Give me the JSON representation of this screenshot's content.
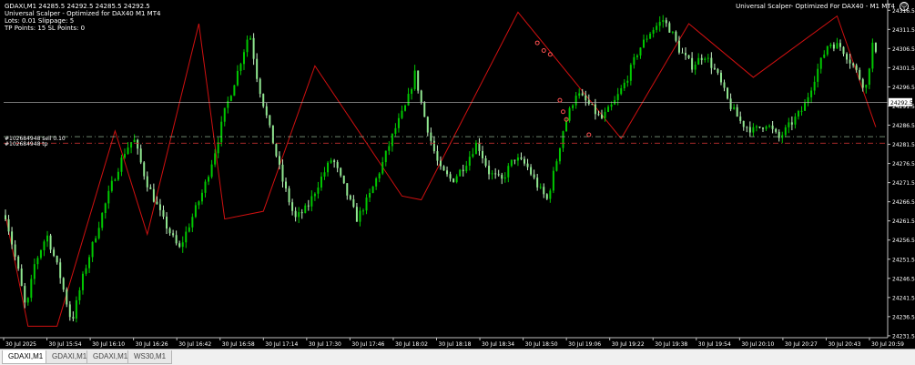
{
  "chart_info": {
    "symbol_line": "GDAXI,M1  24285.5 24292.5 24285.5 24292.5",
    "indicator_line": "Universal Scalper - Optimized for DAX40 M1 MT4",
    "lots_line": "Lots: 0.01  Slippage: 5",
    "points_line": "TP Points: 15  SL Points: 0"
  },
  "indicator_title": "Universal Scalper- Optimized For DAX40 - M1 MT4",
  "smiley_icon": "☺",
  "orders": {
    "sell_label": "#102684948 sell 0.10",
    "tp_label": "#102684948 tp"
  },
  "tabs": [
    {
      "label": "GDAXI,M1",
      "active": true
    },
    {
      "label": "GDAXI,M1",
      "active": false
    },
    {
      "label": "GDAXI,M1",
      "active": false
    },
    {
      "label": "WS30,M1",
      "active": false
    }
  ],
  "colors": {
    "background": "#000000",
    "candle_bull": "#00c800",
    "candle_bear": "#c8f0c8",
    "zigzag": "#d01010",
    "axis": "#c0c0c0",
    "bid_line": "#c0c0c0",
    "sell_line": "#90b090",
    "tp_line": "#c03030",
    "markers": "#ff5050"
  },
  "chart_data": {
    "type": "candlestick",
    "symbol": "GDAXI",
    "timeframe": "M1",
    "ylim": [
      24231.0,
      24318.0
    ],
    "y_ticks": [
      "24316.5",
      "24311.5",
      "24306.5",
      "24301.5",
      "24296.5",
      "24291.5",
      "24286.5",
      "24281.5",
      "24276.5",
      "24271.5",
      "24266.5",
      "24261.5",
      "24256.5",
      "24251.5",
      "24246.5",
      "24241.5",
      "24236.5",
      "24231.5"
    ],
    "x_ticks": [
      "30 Jul 2025",
      "30 Jul 15:54",
      "30 Jul 16:10",
      "30 Jul 16:26",
      "30 Jul 16:42",
      "30 Jul 16:58",
      "30 Jul 17:14",
      "30 Jul 17:30",
      "30 Jul 17:46",
      "30 Jul 18:02",
      "30 Jul 18:18",
      "30 Jul 18:34",
      "30 Jul 18:50",
      "30 Jul 19:06",
      "30 Jul 19:22",
      "30 Jul 19:38",
      "30 Jul 19:54",
      "30 Jul 20:10",
      "30 Jul 20:27",
      "30 Jul 20:43",
      "30 Jul 20:59"
    ],
    "current_price": "24292.5",
    "bid": 24292.5,
    "sell_price": 24283.5,
    "tp_price": 24281.8,
    "grid": false,
    "path": [
      [
        0,
        24263
      ],
      [
        3,
        24249
      ],
      [
        5,
        24238
      ],
      [
        7,
        24250
      ],
      [
        10,
        24258
      ],
      [
        13,
        24248
      ],
      [
        16,
        24235
      ],
      [
        19,
        24248
      ],
      [
        23,
        24262
      ],
      [
        26,
        24272
      ],
      [
        29,
        24280
      ],
      [
        31,
        24283
      ],
      [
        34,
        24272
      ],
      [
        38,
        24262
      ],
      [
        42,
        24254
      ],
      [
        45,
        24262
      ],
      [
        48,
        24270
      ],
      [
        51,
        24281
      ],
      [
        53,
        24290
      ],
      [
        56,
        24300
      ],
      [
        59,
        24311
      ],
      [
        61,
        24298
      ],
      [
        64,
        24285
      ],
      [
        67,
        24272
      ],
      [
        70,
        24262
      ],
      [
        73,
        24265
      ],
      [
        76,
        24272
      ],
      [
        79,
        24278
      ],
      [
        82,
        24270
      ],
      [
        85,
        24262
      ],
      [
        88,
        24268
      ],
      [
        91,
        24276
      ],
      [
        94,
        24285
      ],
      [
        97,
        24292
      ],
      [
        99,
        24300
      ],
      [
        101,
        24290
      ],
      [
        103,
        24282
      ],
      [
        105,
        24275
      ],
      [
        108,
        24272
      ],
      [
        111,
        24276
      ],
      [
        114,
        24282
      ],
      [
        117,
        24274
      ],
      [
        120,
        24272
      ],
      [
        123,
        24278
      ],
      [
        126,
        24276
      ],
      [
        129,
        24270
      ],
      [
        131,
        24267
      ],
      [
        133,
        24276
      ],
      [
        135,
        24286
      ],
      [
        138,
        24295
      ],
      [
        141,
        24292
      ],
      [
        144,
        24288
      ],
      [
        147,
        24292
      ],
      [
        150,
        24298
      ],
      [
        153,
        24306
      ],
      [
        156,
        24311
      ],
      [
        159,
        24314
      ],
      [
        161,
        24311
      ],
      [
        163,
        24306
      ],
      [
        166,
        24302
      ],
      [
        169,
        24305
      ],
      [
        172,
        24300
      ],
      [
        175,
        24292
      ],
      [
        178,
        24287
      ],
      [
        181,
        24285
      ],
      [
        184,
        24287
      ],
      [
        187,
        24283
      ],
      [
        190,
        24287
      ],
      [
        193,
        24291
      ],
      [
        196,
        24300
      ],
      [
        199,
        24308
      ],
      [
        202,
        24307
      ],
      [
        205,
        24302
      ],
      [
        208,
        24296
      ],
      [
        210,
        24310
      ],
      [
        212,
        24286
      ]
    ],
    "zigzag": [
      [
        0,
        24263
      ],
      [
        7,
        24234
      ],
      [
        16,
        24234
      ],
      [
        34,
        24285
      ],
      [
        44,
        24258
      ],
      [
        60,
        24313
      ],
      [
        68,
        24262
      ],
      [
        80,
        24264
      ],
      [
        96,
        24302
      ],
      [
        123,
        24268
      ],
      [
        129,
        24267
      ],
      [
        159,
        24316
      ],
      [
        191,
        24283
      ],
      [
        212,
        24313
      ],
      [
        232,
        24299
      ],
      [
        258,
        24315
      ],
      [
        270,
        24286
      ]
    ],
    "markers": [
      [
        165,
        24308
      ],
      [
        167,
        24306
      ],
      [
        169,
        24305
      ],
      [
        172,
        24293
      ],
      [
        173,
        24290
      ],
      [
        174,
        24288
      ],
      [
        181,
        24284
      ]
    ]
  }
}
